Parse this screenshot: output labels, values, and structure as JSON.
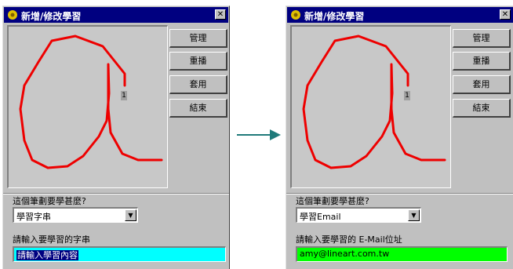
{
  "colors": {
    "title_bar": "#000080",
    "stroke": "#ee0000",
    "input_left_bg": "#00ffff",
    "input_right_bg": "#00ff00",
    "arrow": "#1f7a7a"
  },
  "icons": {
    "title": "app-flower-icon",
    "close": "close-icon",
    "dropdown": "chevron-down-icon",
    "arrow": "arrow-right-icon"
  },
  "left_window": {
    "title": "新增/修改學習",
    "close_label": "✕",
    "marker_label": "1",
    "buttons": [
      "管理",
      "重播",
      "套用",
      "結束"
    ],
    "group_label": "這個筆劃要學甚麼?",
    "dropdown_value": "學習字串",
    "input_label": "請輸入要學習的字串",
    "input_value": "請輸入學習內容"
  },
  "right_window": {
    "title": "新增/修改學習",
    "close_label": "✕",
    "marker_label": "1",
    "buttons": [
      "管理",
      "重播",
      "套用",
      "結束"
    ],
    "group_label": "這個筆劃要學甚麼?",
    "dropdown_value": "學習Email",
    "input_label": "請輸入要學習的 E-Mail位址",
    "input_value": "amy@lineart.com.tw"
  }
}
